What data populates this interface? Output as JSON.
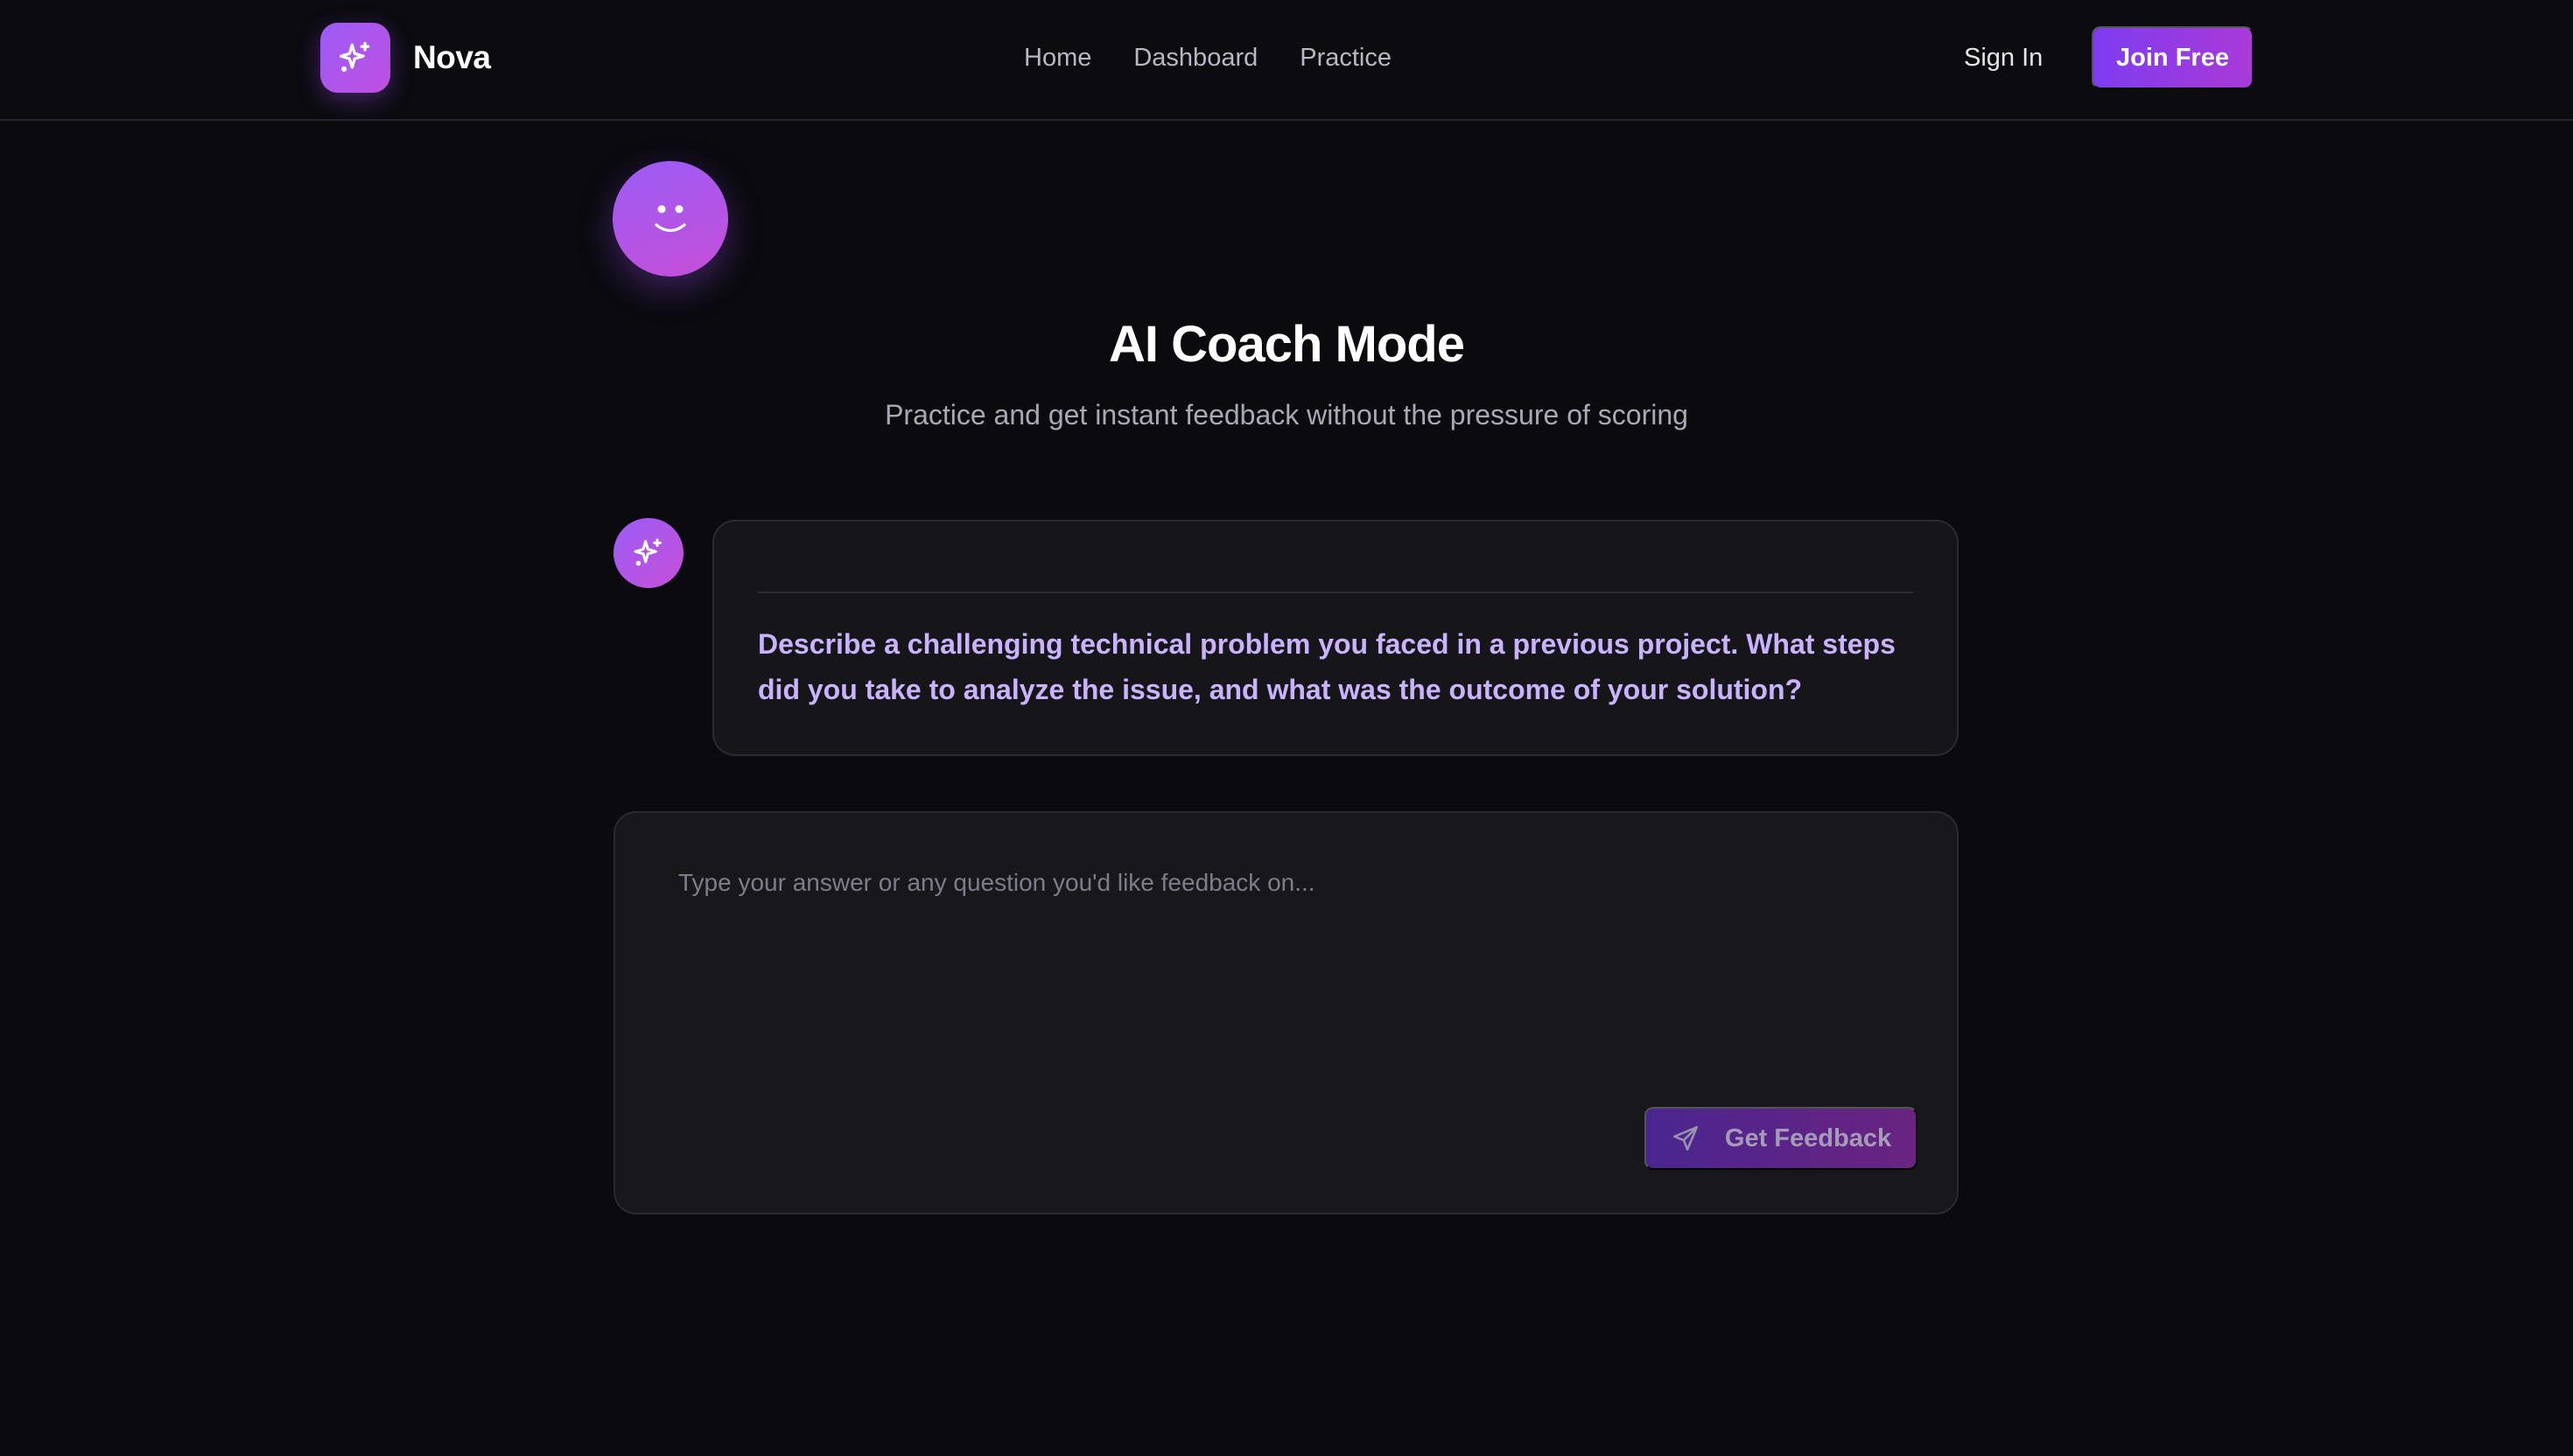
{
  "nav": {
    "brand": "Nova",
    "links": [
      "Home",
      "Dashboard",
      "Practice"
    ],
    "sign_in": "Sign In",
    "join": "Join Free"
  },
  "hero": {
    "title": "AI Coach Mode",
    "subtitle": "Practice and get instant feedback without the pressure of scoring"
  },
  "question": {
    "text": "Describe a challenging technical problem you faced in a previous project. What steps did you take to analyze the issue, and what was the outcome of your solution?"
  },
  "answer": {
    "value": "",
    "placeholder": "Type your answer or any question you'd like feedback on...",
    "submit_label": "Get Feedback"
  },
  "icons": {
    "brand": "sparkles-icon",
    "coach_avatar": "smiley-face-icon",
    "bot": "sparkles-icon",
    "submit": "send-icon"
  },
  "colors": {
    "background": "#0a0a0f",
    "accent_start": "#9b5cf6",
    "accent_end": "#c64fd8",
    "question_text": "#c9b3ff"
  }
}
